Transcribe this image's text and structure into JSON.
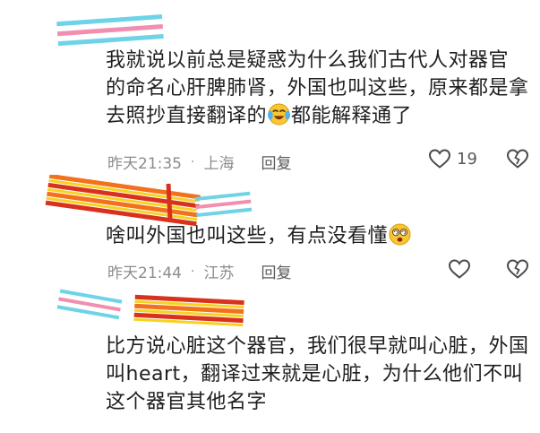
{
  "comments": [
    {
      "text_lines": [
        "我就说以前总是疑惑为什么我们古代人对器官",
        "的命名心肝脾肺肾，外国也叫这些，原来都是拿",
        "去照抄直接翻译的"
      ],
      "text_after_emoji": "都能解释通了",
      "emoji": "crying-laughing-emoji",
      "time": "昨天21:35",
      "location": "上海",
      "reply_label": "回复",
      "like_count": "19"
    },
    {
      "text_lines": [
        "啥叫外国也叫这些，有点没看懂"
      ],
      "emoji": "dizzy-face-emoji",
      "time": "昨天21:44",
      "location": "江苏",
      "reply_label": "回复"
    },
    {
      "text_lines": [
        "比方说心脏这个器官，我们很早就叫心脏，外国",
        "叫heart，翻译过来就是心脏，为什么他们不叫",
        "这个器官其他名字"
      ]
    }
  ],
  "separator_dot": "·",
  "colors": {
    "text": "#1f1f1f",
    "meta": "#8c8c8c",
    "redact_cyan": "#6fd3e8",
    "redact_pink": "#f08fb0",
    "redact_orange": "#f2711c",
    "redact_red": "#d8321e",
    "redact_yellow": "#f7d21e"
  }
}
